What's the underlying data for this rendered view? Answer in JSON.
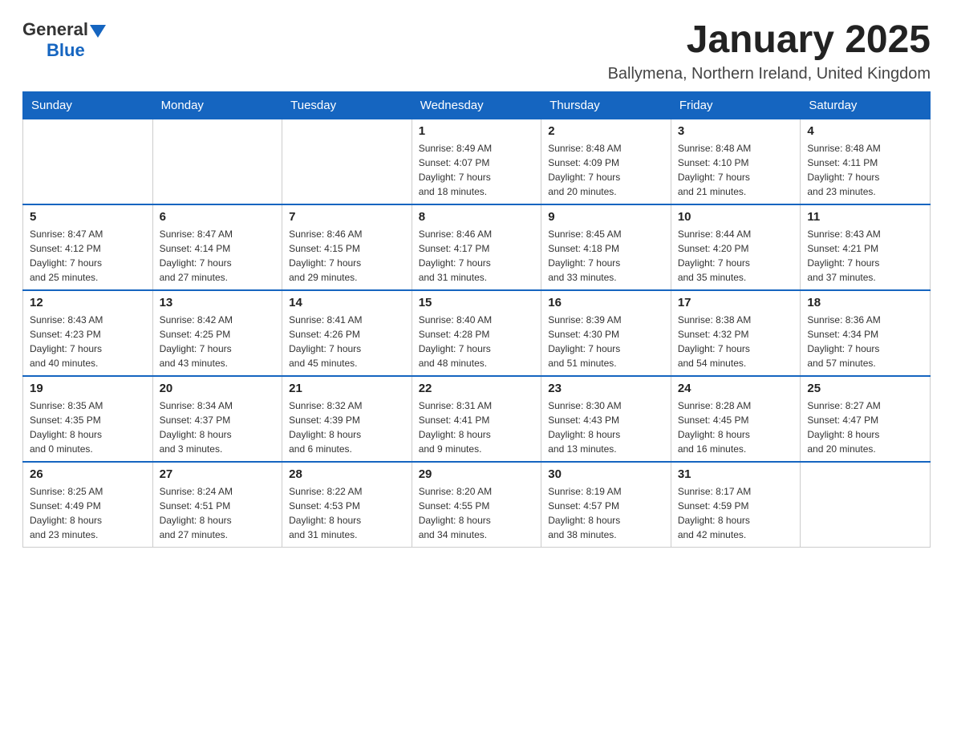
{
  "header": {
    "logo_general": "General",
    "logo_blue": "Blue",
    "title": "January 2025",
    "subtitle": "Ballymena, Northern Ireland, United Kingdom"
  },
  "days_of_week": [
    "Sunday",
    "Monday",
    "Tuesday",
    "Wednesday",
    "Thursday",
    "Friday",
    "Saturday"
  ],
  "weeks": [
    [
      {
        "day": "",
        "info": ""
      },
      {
        "day": "",
        "info": ""
      },
      {
        "day": "",
        "info": ""
      },
      {
        "day": "1",
        "info": "Sunrise: 8:49 AM\nSunset: 4:07 PM\nDaylight: 7 hours\nand 18 minutes."
      },
      {
        "day": "2",
        "info": "Sunrise: 8:48 AM\nSunset: 4:09 PM\nDaylight: 7 hours\nand 20 minutes."
      },
      {
        "day": "3",
        "info": "Sunrise: 8:48 AM\nSunset: 4:10 PM\nDaylight: 7 hours\nand 21 minutes."
      },
      {
        "day": "4",
        "info": "Sunrise: 8:48 AM\nSunset: 4:11 PM\nDaylight: 7 hours\nand 23 minutes."
      }
    ],
    [
      {
        "day": "5",
        "info": "Sunrise: 8:47 AM\nSunset: 4:12 PM\nDaylight: 7 hours\nand 25 minutes."
      },
      {
        "day": "6",
        "info": "Sunrise: 8:47 AM\nSunset: 4:14 PM\nDaylight: 7 hours\nand 27 minutes."
      },
      {
        "day": "7",
        "info": "Sunrise: 8:46 AM\nSunset: 4:15 PM\nDaylight: 7 hours\nand 29 minutes."
      },
      {
        "day": "8",
        "info": "Sunrise: 8:46 AM\nSunset: 4:17 PM\nDaylight: 7 hours\nand 31 minutes."
      },
      {
        "day": "9",
        "info": "Sunrise: 8:45 AM\nSunset: 4:18 PM\nDaylight: 7 hours\nand 33 minutes."
      },
      {
        "day": "10",
        "info": "Sunrise: 8:44 AM\nSunset: 4:20 PM\nDaylight: 7 hours\nand 35 minutes."
      },
      {
        "day": "11",
        "info": "Sunrise: 8:43 AM\nSunset: 4:21 PM\nDaylight: 7 hours\nand 37 minutes."
      }
    ],
    [
      {
        "day": "12",
        "info": "Sunrise: 8:43 AM\nSunset: 4:23 PM\nDaylight: 7 hours\nand 40 minutes."
      },
      {
        "day": "13",
        "info": "Sunrise: 8:42 AM\nSunset: 4:25 PM\nDaylight: 7 hours\nand 43 minutes."
      },
      {
        "day": "14",
        "info": "Sunrise: 8:41 AM\nSunset: 4:26 PM\nDaylight: 7 hours\nand 45 minutes."
      },
      {
        "day": "15",
        "info": "Sunrise: 8:40 AM\nSunset: 4:28 PM\nDaylight: 7 hours\nand 48 minutes."
      },
      {
        "day": "16",
        "info": "Sunrise: 8:39 AM\nSunset: 4:30 PM\nDaylight: 7 hours\nand 51 minutes."
      },
      {
        "day": "17",
        "info": "Sunrise: 8:38 AM\nSunset: 4:32 PM\nDaylight: 7 hours\nand 54 minutes."
      },
      {
        "day": "18",
        "info": "Sunrise: 8:36 AM\nSunset: 4:34 PM\nDaylight: 7 hours\nand 57 minutes."
      }
    ],
    [
      {
        "day": "19",
        "info": "Sunrise: 8:35 AM\nSunset: 4:35 PM\nDaylight: 8 hours\nand 0 minutes."
      },
      {
        "day": "20",
        "info": "Sunrise: 8:34 AM\nSunset: 4:37 PM\nDaylight: 8 hours\nand 3 minutes."
      },
      {
        "day": "21",
        "info": "Sunrise: 8:32 AM\nSunset: 4:39 PM\nDaylight: 8 hours\nand 6 minutes."
      },
      {
        "day": "22",
        "info": "Sunrise: 8:31 AM\nSunset: 4:41 PM\nDaylight: 8 hours\nand 9 minutes."
      },
      {
        "day": "23",
        "info": "Sunrise: 8:30 AM\nSunset: 4:43 PM\nDaylight: 8 hours\nand 13 minutes."
      },
      {
        "day": "24",
        "info": "Sunrise: 8:28 AM\nSunset: 4:45 PM\nDaylight: 8 hours\nand 16 minutes."
      },
      {
        "day": "25",
        "info": "Sunrise: 8:27 AM\nSunset: 4:47 PM\nDaylight: 8 hours\nand 20 minutes."
      }
    ],
    [
      {
        "day": "26",
        "info": "Sunrise: 8:25 AM\nSunset: 4:49 PM\nDaylight: 8 hours\nand 23 minutes."
      },
      {
        "day": "27",
        "info": "Sunrise: 8:24 AM\nSunset: 4:51 PM\nDaylight: 8 hours\nand 27 minutes."
      },
      {
        "day": "28",
        "info": "Sunrise: 8:22 AM\nSunset: 4:53 PM\nDaylight: 8 hours\nand 31 minutes."
      },
      {
        "day": "29",
        "info": "Sunrise: 8:20 AM\nSunset: 4:55 PM\nDaylight: 8 hours\nand 34 minutes."
      },
      {
        "day": "30",
        "info": "Sunrise: 8:19 AM\nSunset: 4:57 PM\nDaylight: 8 hours\nand 38 minutes."
      },
      {
        "day": "31",
        "info": "Sunrise: 8:17 AM\nSunset: 4:59 PM\nDaylight: 8 hours\nand 42 minutes."
      },
      {
        "day": "",
        "info": ""
      }
    ]
  ]
}
